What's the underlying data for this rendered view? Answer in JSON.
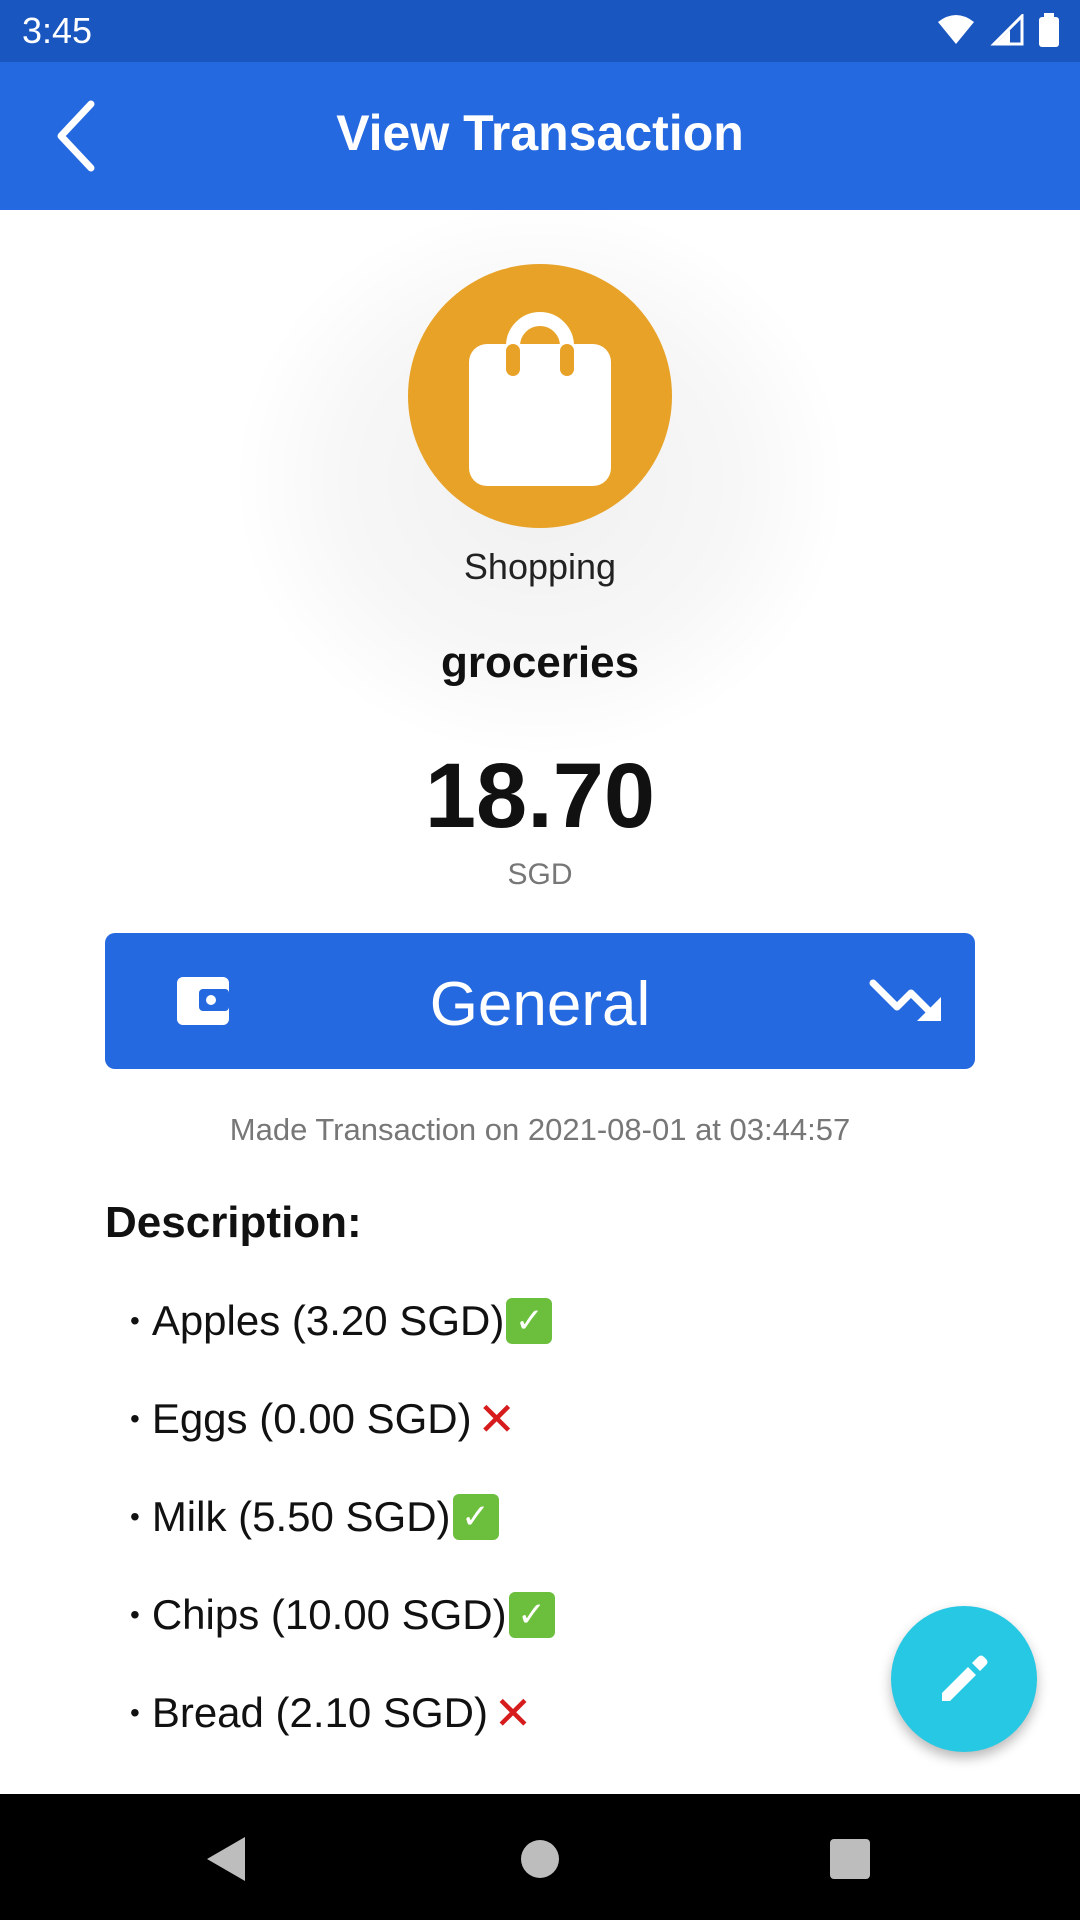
{
  "status_bar": {
    "time": "3:45",
    "icons": [
      "wifi-icon",
      "signal-icon",
      "battery-icon"
    ]
  },
  "app_bar": {
    "title": "View Transaction",
    "back_icon": "back-arrow-icon"
  },
  "category": {
    "label": "Shopping",
    "icon": "shopping-bag-icon",
    "color": "#e7a227"
  },
  "transaction": {
    "name": "groceries",
    "amount": "18.70",
    "currency": "SGD",
    "made_on": "Made Transaction on 2021-08-01 at 03:44:57"
  },
  "account": {
    "name": "General",
    "icon": "wallet-icon",
    "type_icon": "trending-down-icon",
    "color": "#2569e0"
  },
  "description": {
    "title": "Description:",
    "items": [
      {
        "text": "Apples (3.20 SGD)",
        "status": "check"
      },
      {
        "text": "Eggs (0.00 SGD)",
        "status": "cross"
      },
      {
        "text": "Milk (5.50 SGD)",
        "status": "check"
      },
      {
        "text": "Chips (10.00 SGD)",
        "status": "check"
      },
      {
        "text": "Bread (2.10 SGD)",
        "status": "cross"
      }
    ]
  },
  "fab": {
    "icon": "edit-pencil-icon",
    "color": "#27c8e3"
  },
  "nav_bar": {
    "buttons": [
      "back-triangle-icon",
      "home-circle-icon",
      "recents-square-icon"
    ]
  }
}
